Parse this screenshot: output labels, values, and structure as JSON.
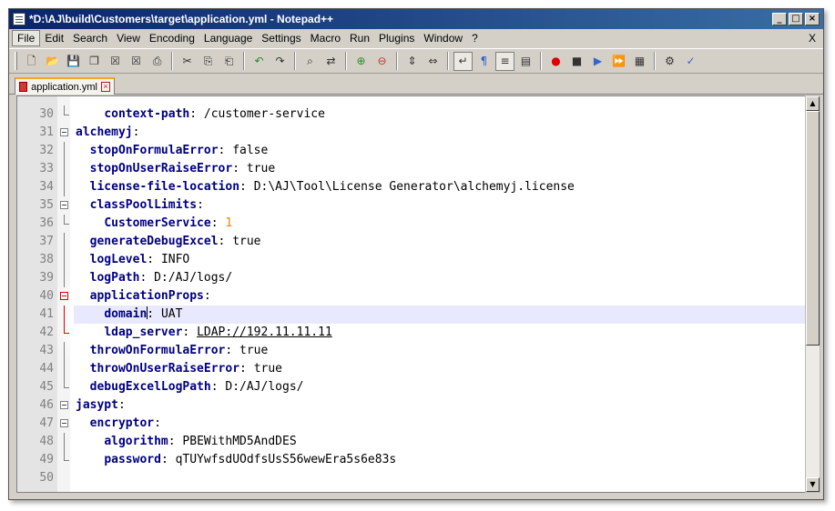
{
  "window": {
    "title": "*D:\\AJ\\build\\Customers\\target\\application.yml - Notepad++",
    "buttons": {
      "minimize": "_",
      "maximize": "□",
      "close": "×"
    }
  },
  "menu": {
    "items": [
      "File",
      "Edit",
      "Search",
      "View",
      "Encoding",
      "Language",
      "Settings",
      "Macro",
      "Run",
      "Plugins",
      "Window",
      "?"
    ],
    "close": "X"
  },
  "toolbar": {
    "icons": [
      "new-file-icon",
      "open-file-icon",
      "save-icon",
      "save-all-icon",
      "close-icon",
      "close-all-icon",
      "print-icon",
      "cut-icon",
      "copy-icon",
      "paste-icon",
      "undo-icon",
      "redo-icon",
      "find-icon",
      "replace-icon",
      "zoom-in-icon",
      "zoom-out-icon",
      "sync-vertical-icon",
      "sync-horizontal-icon",
      "word-wrap-icon",
      "show-all-chars-icon",
      "indent-guide-icon",
      "doc-map-icon",
      "record-macro-icon",
      "stop-macro-icon",
      "play-macro-icon",
      "run-macro-multiple-icon",
      "save-macro-icon",
      "plugin-icon",
      "spellcheck-icon"
    ]
  },
  "tabs": [
    {
      "label": "application.yml",
      "close": "×"
    }
  ],
  "editor": {
    "lines": [
      {
        "num": "30",
        "indent": "    ",
        "key": "context-path",
        "sep": ": ",
        "val": "/customer-service",
        "type": "str"
      },
      {
        "num": "31",
        "indent": "",
        "key": "alchemyj",
        "sep": ":",
        "val": "",
        "type": "str"
      },
      {
        "num": "32",
        "indent": "  ",
        "key": "stopOnFormulaError",
        "sep": ": ",
        "val": "false",
        "type": "str"
      },
      {
        "num": "33",
        "indent": "  ",
        "key": "stopOnUserRaiseError",
        "sep": ": ",
        "val": "true",
        "type": "str"
      },
      {
        "num": "34",
        "indent": "  ",
        "key": "license-file-location",
        "sep": ": ",
        "val": "D:\\AJ\\Tool\\License Generator\\alchemyj.license",
        "type": "str"
      },
      {
        "num": "35",
        "indent": "  ",
        "key": "classPoolLimits",
        "sep": ":",
        "val": "",
        "type": "str"
      },
      {
        "num": "36",
        "indent": "    ",
        "key": "CustomerService",
        "sep": ": ",
        "val": "1",
        "type": "num"
      },
      {
        "num": "37",
        "indent": "  ",
        "key": "generateDebugExcel",
        "sep": ": ",
        "val": "true",
        "type": "str"
      },
      {
        "num": "38",
        "indent": "  ",
        "key": "logLevel",
        "sep": ": ",
        "val": "INFO",
        "type": "str"
      },
      {
        "num": "39",
        "indent": "  ",
        "key": "logPath",
        "sep": ": ",
        "val": "D:/AJ/logs/",
        "type": "str"
      },
      {
        "num": "40",
        "indent": "  ",
        "key": "applicationProps",
        "sep": ":",
        "val": "",
        "type": "str"
      },
      {
        "num": "41",
        "indent": "    ",
        "key": "domain",
        "sep": ": ",
        "val": "UAT",
        "type": "str"
      },
      {
        "num": "42",
        "indent": "    ",
        "key": "ldap_server",
        "sep": ": ",
        "val": "LDAP://192.11.11.11",
        "type": "link"
      },
      {
        "num": "43",
        "indent": "  ",
        "key": "throwOnFormulaError",
        "sep": ": ",
        "val": "true",
        "type": "str"
      },
      {
        "num": "44",
        "indent": "  ",
        "key": "throwOnUserRaiseError",
        "sep": ": ",
        "val": "true",
        "type": "str"
      },
      {
        "num": "45",
        "indent": "  ",
        "key": "debugExcelLogPath",
        "sep": ": ",
        "val": "D:/AJ/logs/",
        "type": "str"
      },
      {
        "num": "46",
        "indent": "",
        "key": "jasypt",
        "sep": ":",
        "val": "",
        "type": "str"
      },
      {
        "num": "47",
        "indent": "  ",
        "key": "encryptor",
        "sep": ":",
        "val": "",
        "type": "str"
      },
      {
        "num": "48",
        "indent": "    ",
        "key": "algorithm",
        "sep": ": ",
        "val": "PBEWithMD5AndDES",
        "type": "str"
      },
      {
        "num": "49",
        "indent": "    ",
        "key": "password",
        "sep": ": ",
        "val": "qTUYwfsdUOdfsUsS56wewEra5s6e83s",
        "type": "str"
      },
      {
        "num": "50",
        "indent": "",
        "key": "",
        "sep": "",
        "val": "",
        "type": "str"
      }
    ],
    "current_line": "41",
    "colors": {
      "key": "#000080",
      "number": "#ff8000",
      "current_line_bg": "#e8e8ff",
      "fold_highlight": "#dd0000"
    }
  },
  "scrollbar": {
    "up": "▲",
    "down": "▼"
  }
}
